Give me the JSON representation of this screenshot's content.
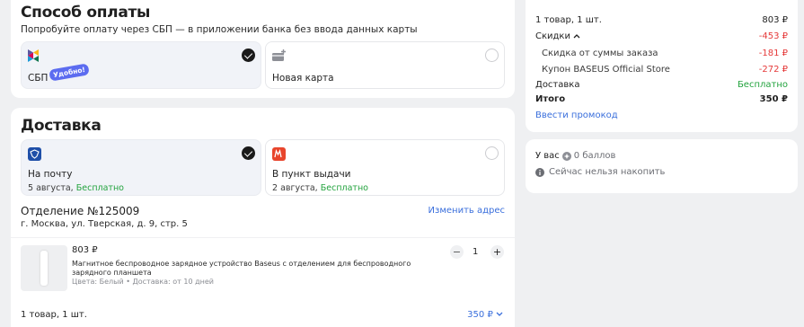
{
  "payment": {
    "title": "Способ оплаты",
    "subtitle": "Попробуйте оплату через СБП — в приложении банка без ввода данных карты",
    "options": [
      {
        "label": "СБП",
        "badge": "Удобно!",
        "selected": true
      },
      {
        "label": "Новая карта",
        "selected": false
      }
    ]
  },
  "delivery": {
    "title": "Доставка",
    "options": [
      {
        "label": "На почту",
        "date": "5 августа,",
        "price": "Бесплатно",
        "selected": true
      },
      {
        "label": "В пункт выдачи",
        "date": "2 августа,",
        "price": "Бесплатно",
        "selected": false
      }
    ],
    "office": "Отделение №125009",
    "address": "г. Москва, ул. Тверская, д. 9, стр. 5",
    "change_address": "Изменить адрес",
    "item": {
      "price": "803 ₽",
      "name": "Магнитное беспроводное зарядное устройство Baseus с отделением для беспроводного зарядного планшета",
      "meta": "Цвета: Белый • Доставка: от 10 дней",
      "qty": "1",
      "minus": "−",
      "plus": "+"
    },
    "footer_count": "1 товар, 1 шт.",
    "footer_total": "350 ₽"
  },
  "summary": {
    "items_label": "1 товар, 1 шт.",
    "items_value": "803 ₽",
    "discounts_label": "Скидки",
    "discounts_value": "-453 ₽",
    "order_discount_label": "Скидка от суммы заказа",
    "order_discount_value": "-181 ₽",
    "coupon_label": "Купон BASEUS Official Store",
    "coupon_value": "-272 ₽",
    "delivery_label": "Доставка",
    "delivery_value": "Бесплатно",
    "total_label": "Итого",
    "total_value": "350 ₽",
    "promo_link": "Ввести промокод"
  },
  "points": {
    "prefix": "У вас",
    "balance": "0 баллов",
    "note": "Сейчас нельзя накопить"
  },
  "colors": {
    "green": "#23a33e",
    "red": "#e53a3a",
    "link": "#3a6fdc"
  }
}
